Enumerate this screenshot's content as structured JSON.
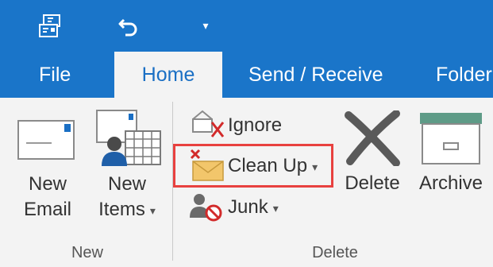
{
  "quick_access": {
    "icons": [
      "send-receive-all-icon",
      "undo-icon",
      "customize-toolbar-dropdown-icon"
    ],
    "dropdown_glyph": "▾"
  },
  "tabs": [
    {
      "label": "File"
    },
    {
      "label": "Home",
      "active": true
    },
    {
      "label": "Send / Receive"
    },
    {
      "label": "Folder"
    }
  ],
  "ribbon": {
    "new_group": {
      "label": "New",
      "new_email_line1": "New",
      "new_email_line2": "Email",
      "new_items_line1": "New",
      "new_items_line2": "Items",
      "dropdown_glyph": "▾"
    },
    "delete_group": {
      "label": "Delete",
      "ignore_label": "Ignore",
      "cleanup_label": "Clean Up",
      "junk_label": "Junk",
      "delete_label": "Delete",
      "archive_label": "Archive",
      "dropdown_glyph": "▾"
    }
  },
  "colors": {
    "accent": "#1a75c9",
    "ribbon_bg": "#f3f3f3",
    "highlight_box": "#e8413f",
    "delete_x": "#5a5a5a",
    "archive_lid": "#5e9b87"
  }
}
